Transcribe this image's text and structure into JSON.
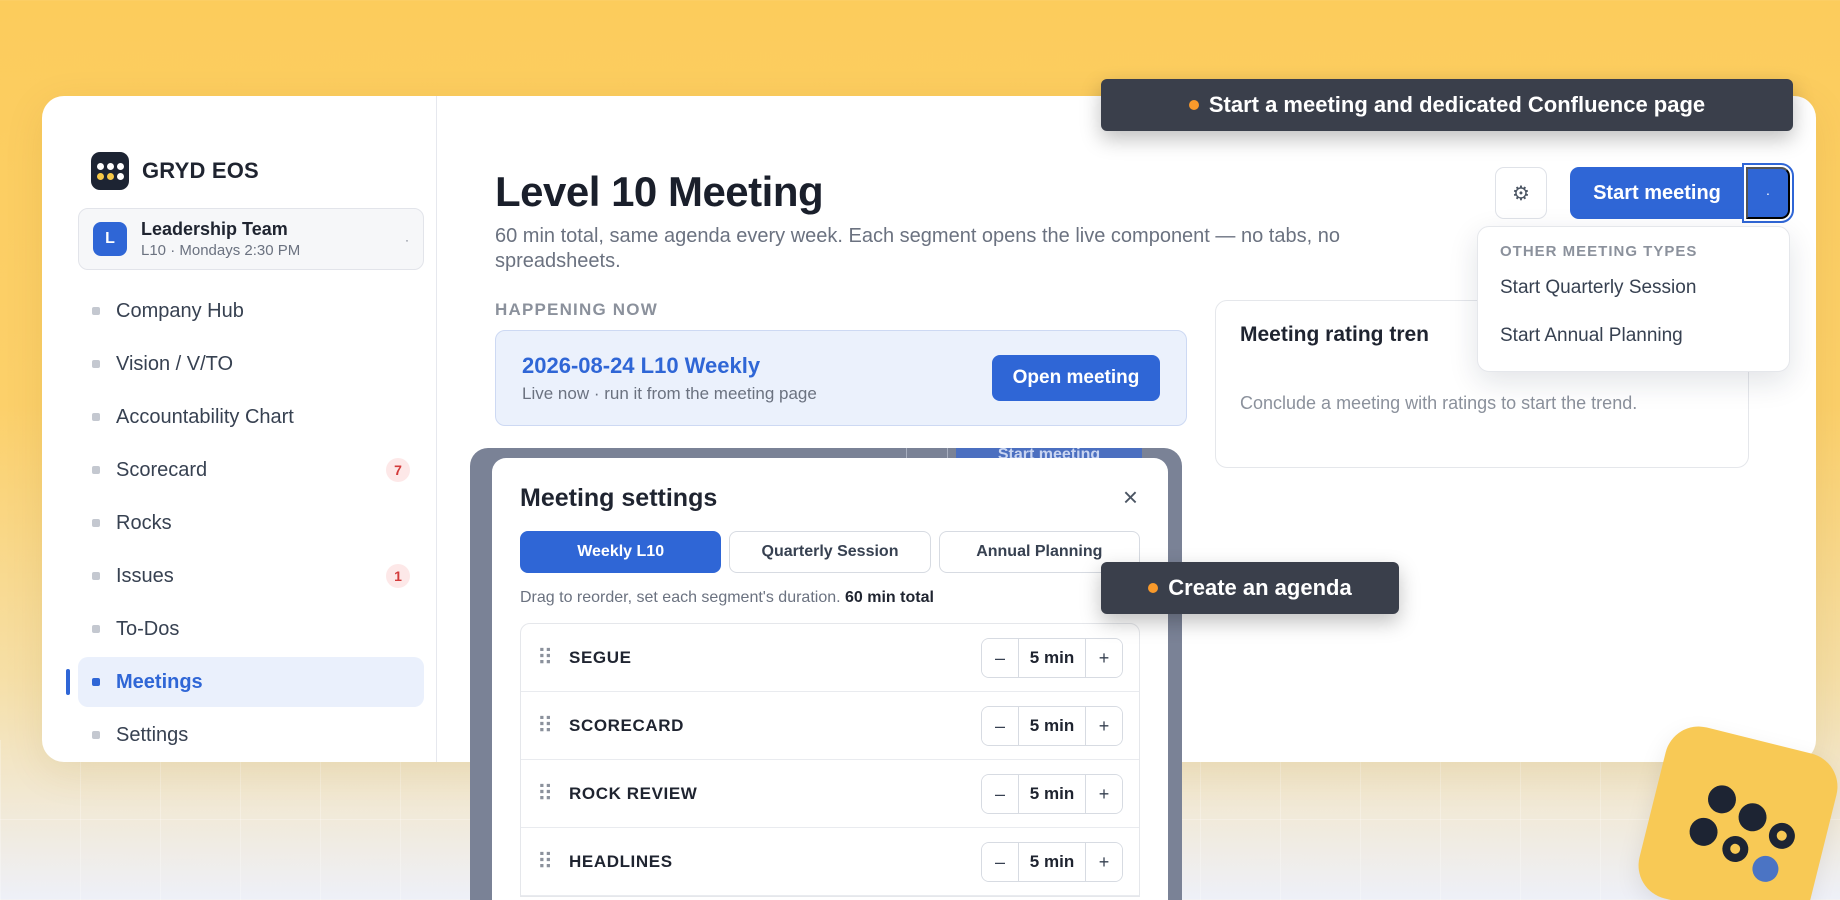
{
  "brand": {
    "name": "GRYD EOS"
  },
  "team": {
    "avatar": "L",
    "name": "Leadership Team",
    "subtitle": "L10 · Mondays 2:30 PM",
    "caret": "·"
  },
  "nav": [
    {
      "label": "Company Hub"
    },
    {
      "label": "Vision / V/TO"
    },
    {
      "label": "Accountability Chart"
    },
    {
      "label": "Scorecard",
      "badge": "7"
    },
    {
      "label": "Rocks"
    },
    {
      "label": "Issues",
      "badge": "1"
    },
    {
      "label": "To-Dos"
    },
    {
      "label": "Meetings",
      "active": true
    },
    {
      "label": "Settings"
    }
  ],
  "page": {
    "title": "Level 10 Meeting",
    "subtitle": "60 min total, same agenda every week. Each segment opens the live component — no tabs, no spreadsheets."
  },
  "toolbar": {
    "gear_icon": "⚙",
    "start_label": "Start meeting",
    "caret": "·"
  },
  "dropdown": {
    "heading": "OTHER MEETING TYPES",
    "items": [
      "Start Quarterly Session",
      "Start Annual Planning"
    ]
  },
  "happening": {
    "label": "HAPPENING NOW",
    "title": "2026-08-24 L10 Weekly",
    "subtitle": "Live now · run it from the meeting page",
    "open_label": "Open meeting"
  },
  "rating": {
    "title": "Meeting rating tren",
    "empty": "Conclude a meeting with ratings to start the trend."
  },
  "modal": {
    "title": "Meeting settings",
    "close_icon": "×",
    "tabs": [
      "Weekly L10",
      "Quarterly Session",
      "Annual Planning"
    ],
    "hint": "Drag to reorder, set each segment's duration.",
    "total": "60 min total",
    "segments": [
      {
        "name": "SEGUE",
        "duration": "5 min"
      },
      {
        "name": "SCORECARD",
        "duration": "5 min"
      },
      {
        "name": "ROCK REVIEW",
        "duration": "5 min"
      },
      {
        "name": "HEADLINES",
        "duration": "5 min"
      }
    ],
    "minus": "–",
    "plus": "+",
    "ghost_start": "Start meeting"
  },
  "callouts": {
    "start": "Start a meeting and dedicated Confluence page",
    "agenda": "Create an agenda"
  },
  "colors": {
    "accent": "#2f66d6",
    "badge": "#d33b3b",
    "callout": "#3a3f4b",
    "callout_dot": "#f99a2b",
    "background": "#fccc5c"
  }
}
